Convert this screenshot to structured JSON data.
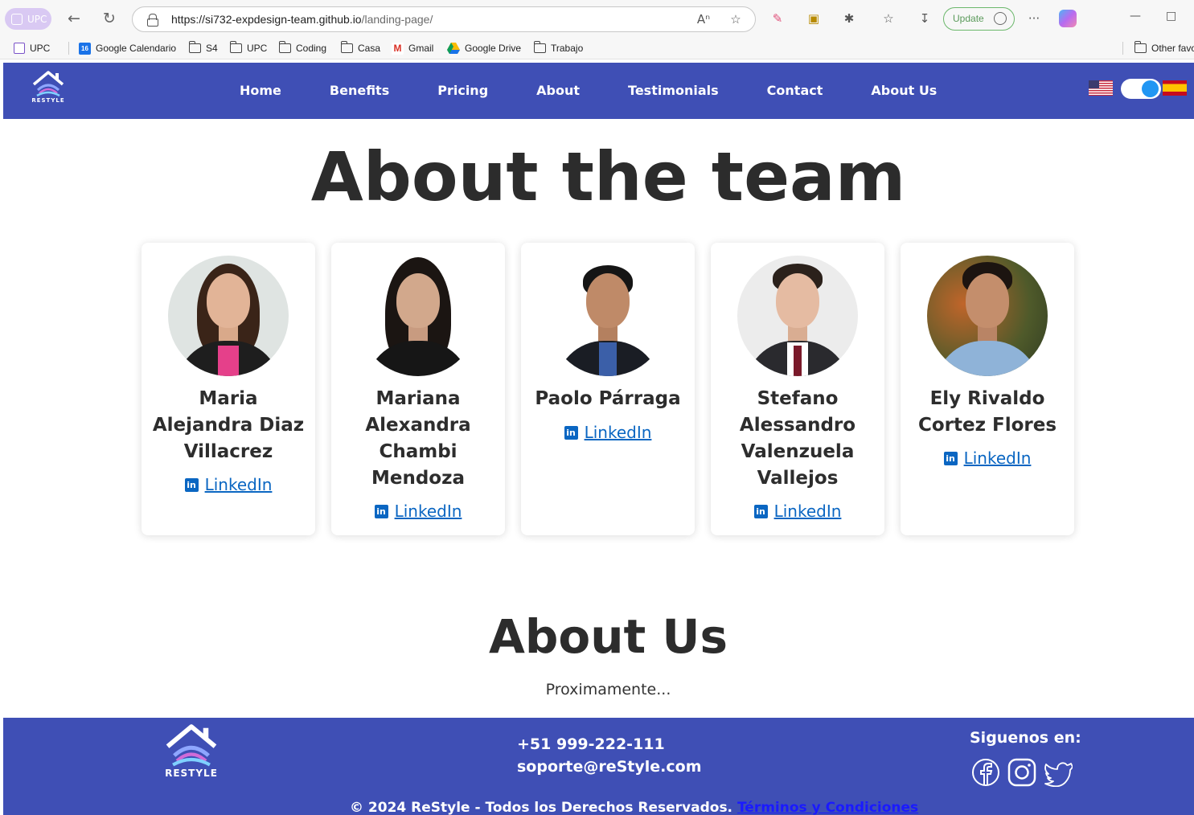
{
  "browser": {
    "profile_label": "UPC",
    "url_host": "https://si732-expdesign-team.github.io",
    "url_path": "/landing-page/",
    "update_label": "Update",
    "more_label": "···"
  },
  "bookmarks": {
    "items": [
      {
        "label": "UPC",
        "icon": "upc-icon"
      },
      {
        "label": "Google Calendario",
        "icon": "calendar-icon",
        "badge": "16"
      },
      {
        "label": "S4",
        "icon": "folder-icon"
      },
      {
        "label": "UPC",
        "icon": "folder-icon"
      },
      {
        "label": "Coding",
        "icon": "folder-icon"
      },
      {
        "label": "Casa",
        "icon": "folder-icon"
      },
      {
        "label": "Gmail",
        "icon": "gmail-icon",
        "badge": "M"
      },
      {
        "label": "Google Drive",
        "icon": "drive-icon"
      },
      {
        "label": "Trabajo",
        "icon": "folder-icon"
      }
    ],
    "other_label": "Other favo"
  },
  "site": {
    "brand_color": "#3f4fb5",
    "logo_text": "RESTYLE",
    "nav": [
      "Home",
      "Benefits",
      "Pricing",
      "About",
      "Testimonials",
      "Contact",
      "About Us"
    ],
    "lang_toggle": {
      "left": "english-flag",
      "right": "spanish-flag",
      "state": "on"
    }
  },
  "team": {
    "title": "About the team",
    "link_label": "LinkedIn",
    "members": [
      {
        "name": "Maria Alejandra Diaz Villacrez",
        "link": "LinkedIn"
      },
      {
        "name": "Mariana Alexandra Chambi Mendoza",
        "link": "LinkedIn"
      },
      {
        "name": "Paolo Párraga",
        "link": "LinkedIn"
      },
      {
        "name": "Stefano Alessandro Valenzuela Vallejos",
        "link": "LinkedIn"
      },
      {
        "name": "Ely Rivaldo Cortez Flores",
        "link": "LinkedIn"
      }
    ]
  },
  "about_us": {
    "title": "About Us",
    "text": "Proximamente..."
  },
  "footer": {
    "phone": "+51 999-222-111",
    "email": "soporte@reStyle.com",
    "follow_label": "Siguenos en:",
    "social": [
      "facebook-icon",
      "instagram-icon",
      "twitter-icon"
    ],
    "copyright_prefix": "© 2024",
    "copyright_brand": "ReStyle",
    "copyright_suffix": "- Todos los Derechos Reservados.",
    "terms_link": "Términos y Condiciones"
  }
}
